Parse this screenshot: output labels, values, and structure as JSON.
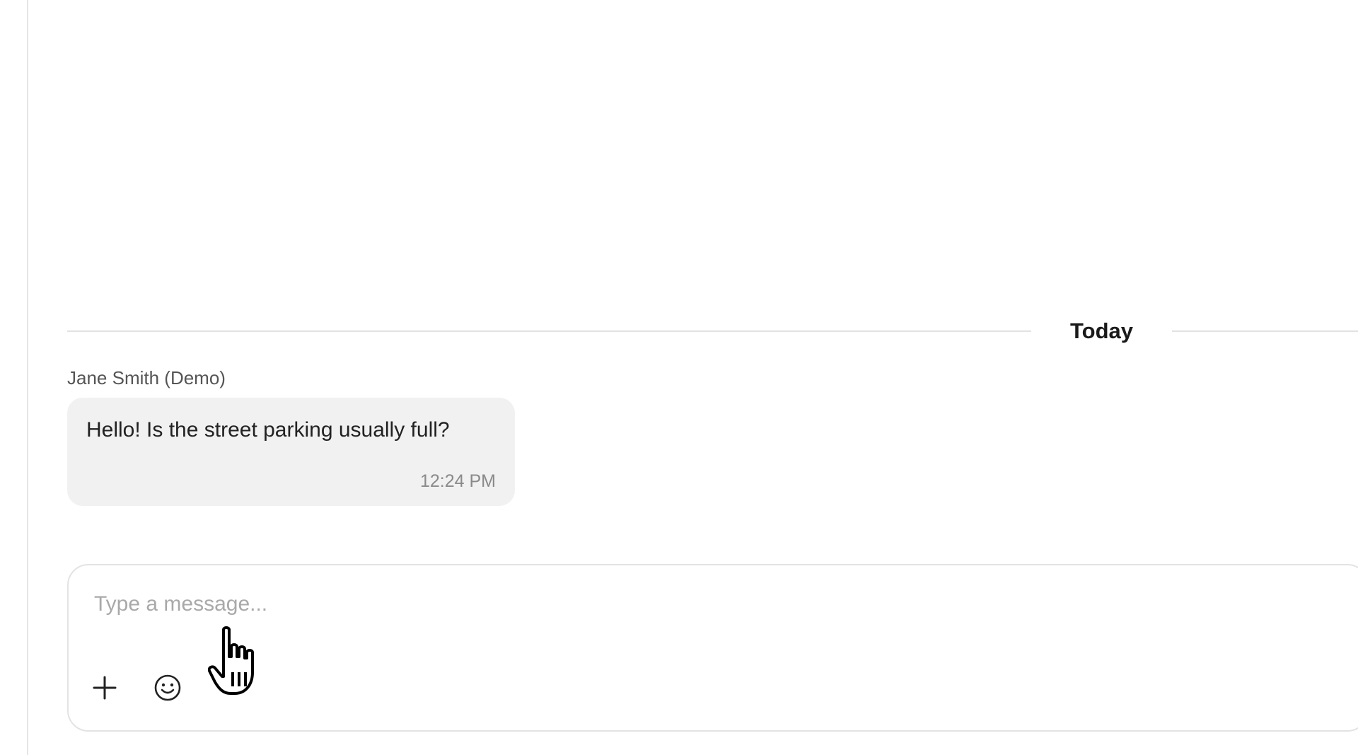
{
  "date_divider": {
    "label": "Today"
  },
  "message": {
    "sender": "Jane Smith (Demo)",
    "text": "Hello! Is the street parking usually full?",
    "time": "12:24 PM"
  },
  "composer": {
    "placeholder": "Type a message...",
    "value": "",
    "add_icon": "plus-icon",
    "emoji_icon": "smiley-icon"
  },
  "colors": {
    "bubble_bg": "#f1f1f1",
    "divider": "#e2e2e2",
    "placeholder": "#a9a9a9"
  }
}
